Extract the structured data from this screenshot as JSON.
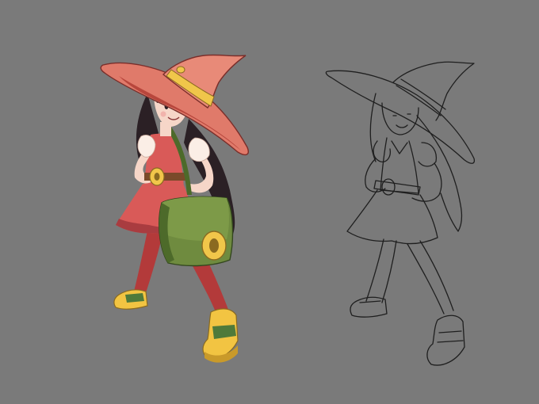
{
  "artwork": {
    "panels": [
      {
        "id": "colored",
        "style": "full-color"
      },
      {
        "id": "lineart",
        "style": "line-art"
      }
    ],
    "colors": {
      "background": "#7a7a7a",
      "hat": "#e07a6a",
      "hat_shade": "#b8463c",
      "hat_band": "#f0c64a",
      "hair": "#2b2025",
      "skin": "#f6d6c8",
      "dress": "#d95a58",
      "dress_dark": "#a93c40",
      "sleeve": "#fbeee6",
      "stockings": "#b33a3a",
      "bag": "#6f8b3f",
      "bag_dark": "#4d6a2a",
      "buckle": "#f1c64a",
      "shoe": "#f2c442",
      "shoe_green": "#4f7a3a",
      "line": "#1f1f1f"
    }
  }
}
